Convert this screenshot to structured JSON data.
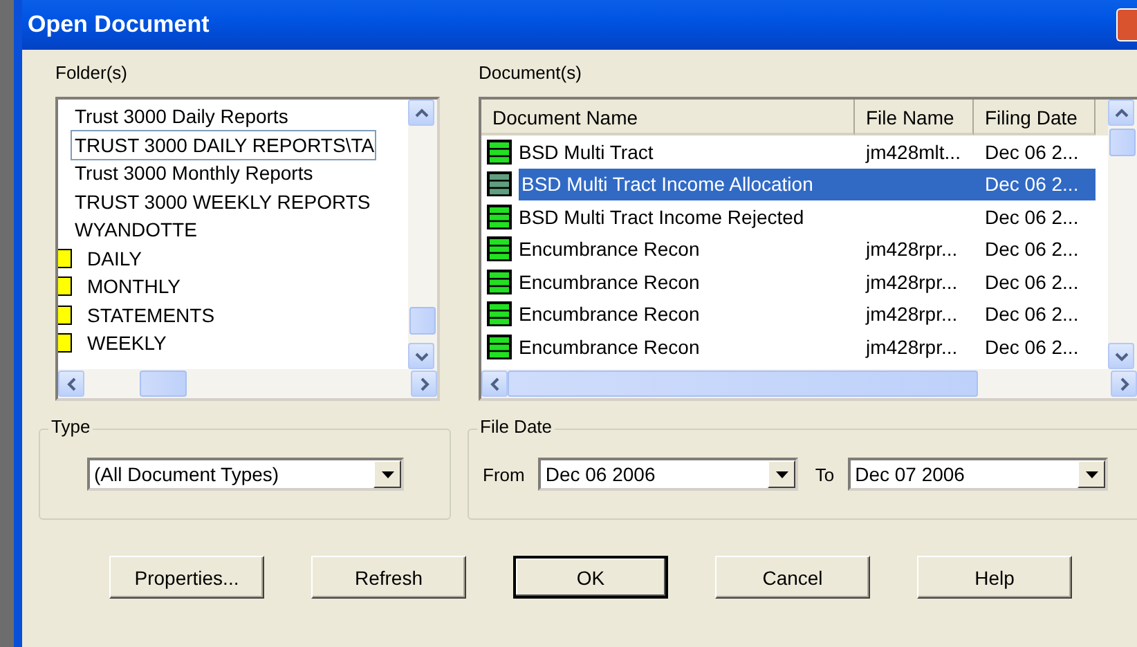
{
  "window": {
    "title": "Open Document"
  },
  "folders": {
    "label": "Folder(s)",
    "items": [
      {
        "name": "Trust 3000 Daily Reports",
        "focused": false
      },
      {
        "name": "TRUST 3000 DAILY REPORTS\\TA",
        "focused": true
      },
      {
        "name": "Trust 3000 Monthly Reports",
        "focused": false
      },
      {
        "name": "TRUST 3000 WEEKLY REPORTS",
        "focused": false
      },
      {
        "name": "WYANDOTTE",
        "focused": false,
        "children": [
          {
            "name": "DAILY",
            "focused": false
          },
          {
            "name": "MONTHLY",
            "focused": false
          },
          {
            "name": "STATEMENTS",
            "focused": false
          },
          {
            "name": "WEEKLY",
            "focused": false
          }
        ]
      }
    ]
  },
  "documents": {
    "label": "Document(s)",
    "columns": [
      "Document Name",
      "File Name",
      "Filing Date"
    ],
    "rows": [
      {
        "name": "BSD Multi Tract",
        "file": "jm428mlt...",
        "date": "Dec 06 2...",
        "selected": false
      },
      {
        "name": "BSD Multi Tract Income Allocation",
        "date": "Dec 06 2...",
        "selected": true
      },
      {
        "name": "BSD Multi Tract Income Rejected",
        "date": "Dec 06 2...",
        "selected": false
      },
      {
        "name": "Encumbrance Recon",
        "file": "jm428rpr...",
        "date": "Dec 06 2...",
        "selected": false
      },
      {
        "name": "Encumbrance Recon",
        "file": "jm428rpr...",
        "date": "Dec 06 2...",
        "selected": false
      },
      {
        "name": "Encumbrance Recon",
        "file": "jm428rpr...",
        "date": "Dec 06 2...",
        "selected": false
      },
      {
        "name": "Encumbrance Recon",
        "file": "jm428rpr...",
        "date": "Dec 06 2...",
        "selected": false
      }
    ]
  },
  "type": {
    "label": "Type",
    "value": "(All Document Types)"
  },
  "file_date": {
    "label": "File Date",
    "from_label": "From",
    "from": "Dec 06 2006",
    "to_label": "To",
    "to": "Dec 07 2006"
  },
  "buttons": [
    {
      "label": "Properties...",
      "default": false
    },
    {
      "label": "Refresh",
      "default": false
    },
    {
      "label": "OK",
      "default": true
    },
    {
      "label": "Cancel",
      "default": false
    },
    {
      "label": "Help",
      "default": false
    }
  ]
}
